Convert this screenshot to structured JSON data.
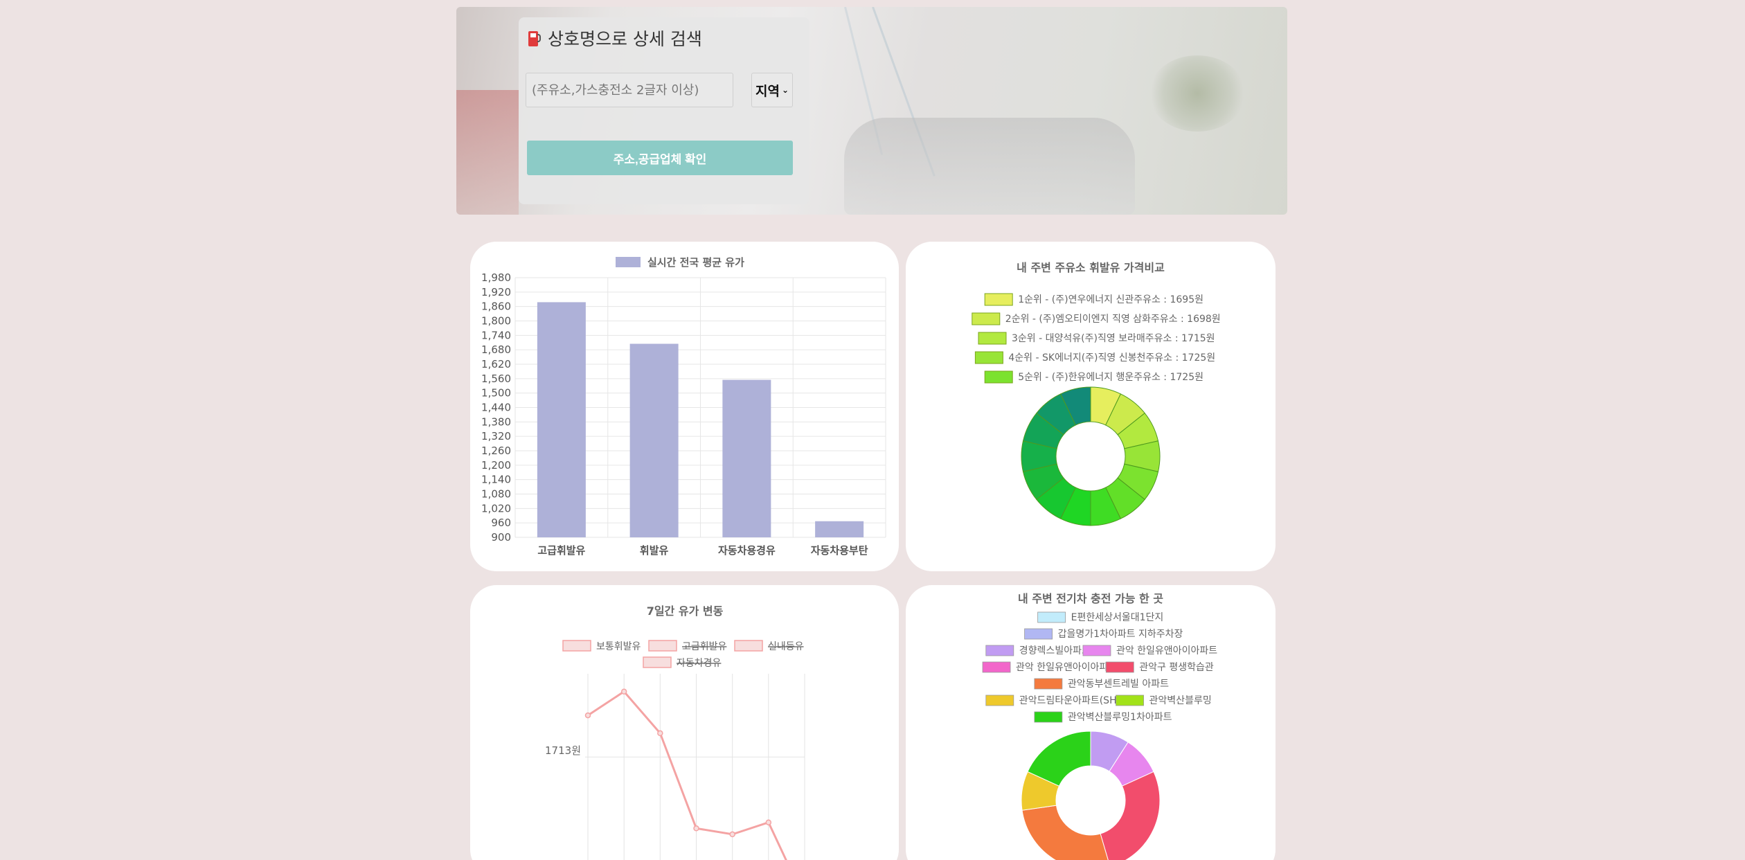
{
  "search": {
    "title": "상호명으로 상세 검색",
    "placeholder": "(주유소,가스충전소 2글자 이상)",
    "region_label": "지역",
    "confirm_label": "주소,공급업체 확인"
  },
  "chart_data": [
    {
      "type": "bar",
      "legend": [
        "실시간 전국 평균 유가"
      ],
      "categories": [
        "고급휘발유",
        "휘발유",
        "자동차용경유",
        "자동차용부탄"
      ],
      "values": [
        1878,
        1705,
        1555,
        967
      ],
      "ylim": [
        900,
        1980
      ],
      "yticks": [
        "1,980",
        "1,920",
        "1,860",
        "1,800",
        "1,740",
        "1,680",
        "1,620",
        "1,560",
        "1,500",
        "1,440",
        "1,380",
        "1,320",
        "1,260",
        "1,200",
        "1,140",
        "1,080",
        "1,020",
        "960",
        "900"
      ],
      "colors": [
        "#aeb1d8"
      ],
      "grid": true
    },
    {
      "type": "pie",
      "title": "내 주변 주유소 휘발유 가격비교",
      "legend": [
        "1순위 - (주)연우에너지 신관주유소 : 1695원",
        "2순위 - (주)엠오티이엔지 직영 삼화주유소 : 1698원",
        "3순위 - 대양석유(주)직영 보라매주유소 : 1715원",
        "4순위 - SK에너지(주)직영 신봉천주유소 : 1725원",
        "5순위 - (주)한유에너지 행운주유소 : 1725원"
      ],
      "slice_count": 14,
      "colors": [
        "#e6ee5e",
        "#ccea4c",
        "#b2e93f",
        "#98e437",
        "#7ce22f",
        "#62df28",
        "#3fdc24",
        "#1fd624",
        "#17c730",
        "#1bb83b",
        "#16b04a",
        "#13a457",
        "#129868",
        "#128a78"
      ]
    },
    {
      "type": "line",
      "title": "7일간 유가 변동",
      "legend": [
        "보통휘발유",
        "고급휘발유",
        "실내등유",
        "자동차경유"
      ],
      "legend_hidden": [
        false,
        true,
        true,
        true
      ],
      "ylabel_tick": "1713원",
      "values": [
        1720,
        1724,
        1717,
        1701,
        1700,
        1702,
        1689
      ],
      "ylim_visible": [
        1693,
        1727
      ],
      "tick_value": 1713,
      "colors": [
        "#f4a3a3"
      ]
    },
    {
      "type": "pie",
      "title": "내 주변 전기차 충전 가능 한 곳",
      "legend": [
        "E편한세상서울대1단지",
        "갑을명가1차아파트 지하주차장",
        "경향렉스빌아파트",
        "관악 한일유앤아이아파트",
        "관악 한일유앤아이아파트",
        "관악구 평생학습관",
        "관악동부센트레빌 아파트",
        "관악드림타운아파트(SH)",
        "관악벽산블루밍",
        "관악벽산블루밍1차아파트"
      ],
      "values": [
        0,
        0,
        1,
        1,
        0,
        3,
        3,
        1,
        0,
        2
      ],
      "colors": [
        "#c2ecfb",
        "#b1b7f3",
        "#c19cf2",
        "#e786ee",
        "#f266ca",
        "#f24d6c",
        "#f47a3e",
        "#eec92c",
        "#a2e219",
        "#2bd219"
      ]
    }
  ]
}
